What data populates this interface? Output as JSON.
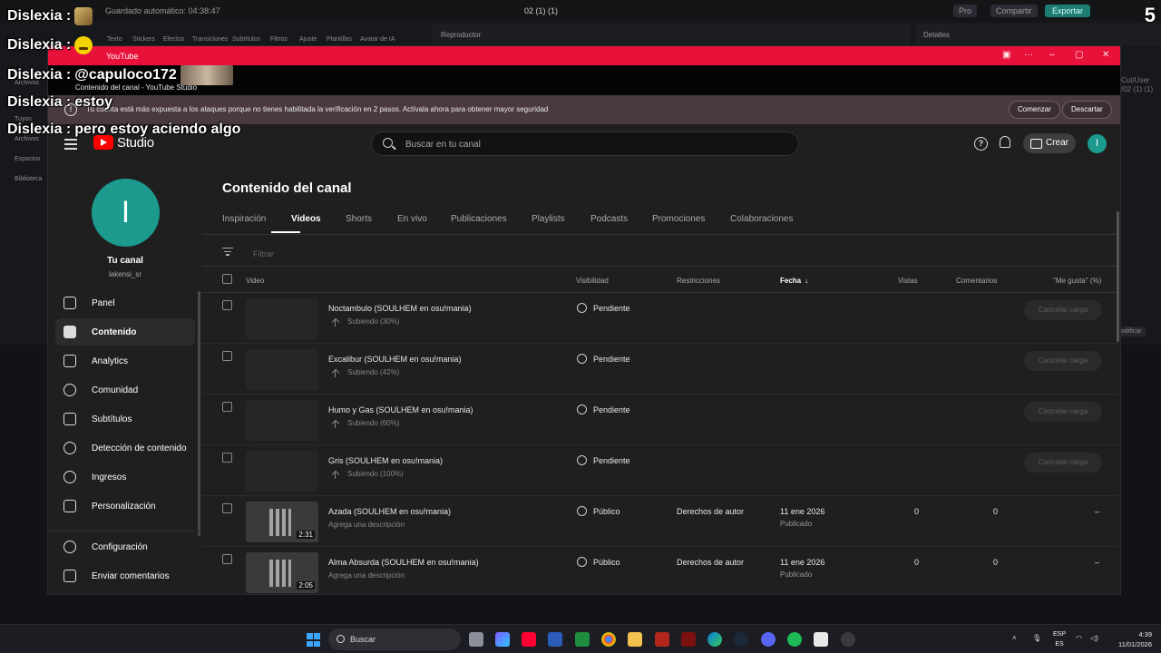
{
  "editor": {
    "autosave": "Guardado automático: 04:38:47",
    "project": "02 (1) (1)",
    "pro": "Pro",
    "share": "Compartir",
    "export": "Exportar",
    "tools": [
      "Texto",
      "Stickers",
      "Efectos",
      "Transiciones",
      "Subtítulos",
      "Filtros",
      "Ajuste",
      "Plantillas",
      "Avatar de IA"
    ],
    "left_items": [
      "Archivos",
      "Tuyos",
      "Archivos",
      "Espacios",
      "Biblioteca"
    ],
    "player": "Reproductor",
    "details": "Detalles",
    "right_misc": "Cut/User\n/02 (1) (1)",
    "modify": "odificar"
  },
  "chat": {
    "lines": [
      {
        "user": "Dislexia :",
        "text": "",
        "emote": "e1"
      },
      {
        "user": "Dislexia :",
        "text": "",
        "emote": "e2"
      },
      {
        "user": "Dislexia :",
        "text": "@capuloco172",
        "emote": "e3"
      },
      {
        "user": "Dislexia :",
        "text": "estoy",
        "emote": ""
      },
      {
        "user": "Dislexia :",
        "text": "pero estoy aciendo algo",
        "emote": ""
      }
    ],
    "counter": "5"
  },
  "window": {
    "title": "YouTube",
    "page_title": "Contenido del canal - YouTube Studio"
  },
  "warning": {
    "text": "Tu cuenta está más expuesta a los ataques porque no tienes habilitada la verificación en 2 pasos. Actívala ahora para obtener mayor seguridad",
    "start": "Comenzar",
    "dismiss": "Descartar"
  },
  "header": {
    "logo_text": "Studio",
    "search_placeholder": "Buscar en tu canal",
    "help": "?",
    "create": "Crear",
    "avatar_initial": "I"
  },
  "sidebar": {
    "avatar_initial": "I",
    "channel_label": "Tu canal",
    "handle": "lakensi_sr",
    "items": [
      {
        "label": "Panel",
        "icon": "dashboard-icon"
      },
      {
        "label": "Contenido",
        "icon": "content-icon",
        "active": true
      },
      {
        "label": "Analytics",
        "icon": "analytics-icon"
      },
      {
        "label": "Comunidad",
        "icon": "community-icon"
      },
      {
        "label": "Subtítulos",
        "icon": "subtitles-icon"
      },
      {
        "label": "Detección de contenido",
        "icon": "copyright-icon"
      },
      {
        "label": "Ingresos",
        "icon": "earn-icon"
      },
      {
        "label": "Personalización",
        "icon": "customization-icon"
      }
    ],
    "bottom": [
      {
        "label": "Configuración",
        "icon": "gear-icon"
      },
      {
        "label": "Enviar comentarios",
        "icon": "feedback-icon"
      }
    ]
  },
  "main": {
    "title": "Contenido del canal",
    "tabs": [
      "Inspiración",
      "Videos",
      "Shorts",
      "En vivo",
      "Publicaciones",
      "Playlists",
      "Podcasts",
      "Promociones",
      "Colaboraciones"
    ],
    "active_tab": "Videos",
    "filter_placeholder": "Filtrar",
    "columns": {
      "video": "Video",
      "visibility": "Visibilidad",
      "restrictions": "Restricciones",
      "date": "Fecha",
      "views": "Vistas",
      "comments": "Comentarios",
      "likes": "\"Me gusta\" (%)"
    },
    "rows": [
      {
        "title": "Noctambulo (SOULHEM en osu!mania)",
        "sub": "Subiendo (30%)",
        "visibility": "Pendiente",
        "action": "Cancelar carga",
        "uploading": true
      },
      {
        "title": "Excalibur (SOULHEM en osu!mania)",
        "sub": "Subiendo (42%)",
        "visibility": "Pendiente",
        "action": "Cancelar carga",
        "uploading": true
      },
      {
        "title": "Humo y Gas (SOULHEM en osu!mania)",
        "sub": "Subiendo (60%)",
        "visibility": "Pendiente",
        "action": "Cancelar carga",
        "uploading": true
      },
      {
        "title": "Gris (SOULHEM en osu!mania)",
        "sub": "Subiendo (100%)",
        "visibility": "Pendiente",
        "action": "Cancelar carga",
        "uploading": true
      },
      {
        "title": "Azada (SOULHEM en osu!mania)",
        "sub": "Agrega una descripción",
        "visibility": "Público",
        "restrictions": "Derechos de autor",
        "date": "11 ene 2026",
        "date_sub": "Publicado",
        "views": "0",
        "comments": "0",
        "likes": "–",
        "duration": "2:31",
        "uploading": false
      },
      {
        "title": "Alma Absurda (SOULHEM en osu!mania)",
        "sub": "Agrega una descripción",
        "visibility": "Público",
        "restrictions": "Derechos de autor",
        "date": "11 ene 2026",
        "date_sub": "Publicado",
        "views": "0",
        "comments": "0",
        "likes": "–",
        "duration": "2:05",
        "uploading": false
      }
    ]
  },
  "taskbar": {
    "search": "Buscar",
    "lang1": "ESP",
    "lang2": "ES",
    "time": "4:39",
    "date": "11/01/2026"
  },
  "colors": {
    "accent_red": "#e8113a",
    "teal_avatar": "#1b9a8d",
    "bg": "#1f1f1f"
  }
}
